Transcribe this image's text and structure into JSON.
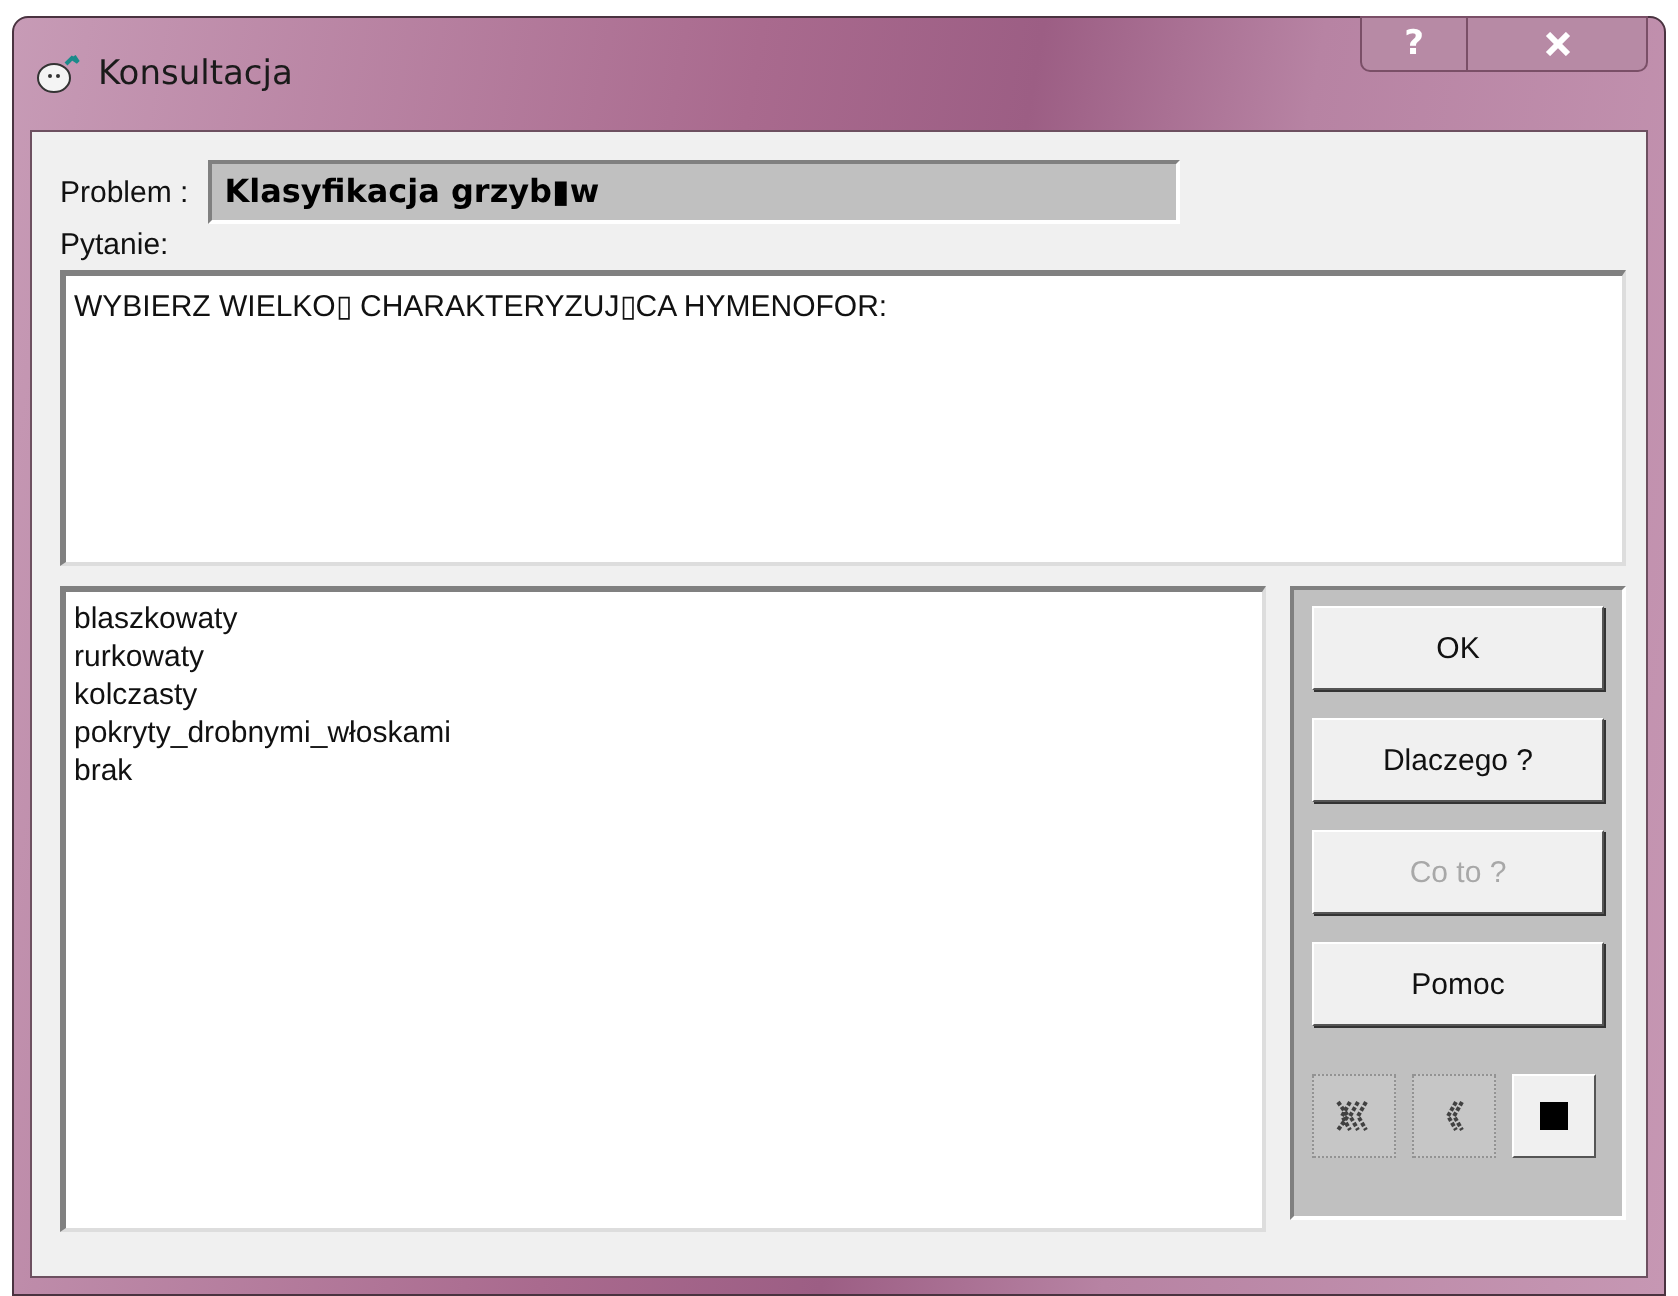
{
  "window": {
    "title": "Konsultacja",
    "help_button": "?"
  },
  "problem": {
    "label": "Problem :",
    "value": "Klasyfikacja grzyb▮w"
  },
  "question": {
    "label": "Pytanie:",
    "text": "WYBIERZ WIELKO▯ CHARAKTERYZUJ▯CA HYMENOFOR:"
  },
  "answers": [
    {
      "label": "blaszkowaty",
      "selected": false
    },
    {
      "label": "rurkowaty",
      "selected": false
    },
    {
      "label": "kolczasty",
      "selected": false
    },
    {
      "label": "pokryty_drobnymi_włoskami",
      "selected": false
    },
    {
      "label": "brak",
      "selected": false
    }
  ],
  "buttons": [
    {
      "label": "OK",
      "disabled": false
    },
    {
      "label": "Dlaczego ?",
      "disabled": false
    },
    {
      "label": "Co to ?",
      "disabled": true
    },
    {
      "label": "Pomoc",
      "disabled": false
    }
  ],
  "media_buttons": [
    {
      "kind": "rewind-all",
      "disabled": true
    },
    {
      "kind": "back",
      "disabled": true
    },
    {
      "kind": "stop",
      "disabled": false
    }
  ]
}
